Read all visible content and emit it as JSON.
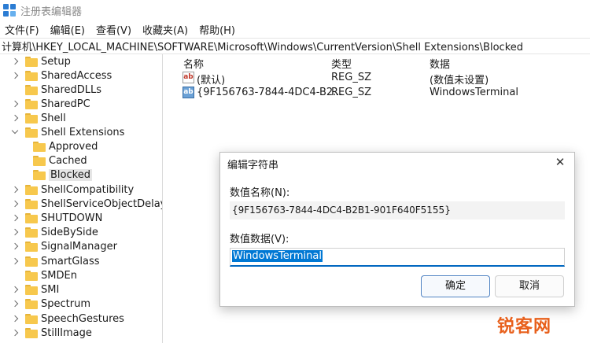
{
  "window": {
    "title": "注册表编辑器"
  },
  "menu": [
    "文件(F)",
    "编辑(E)",
    "查看(V)",
    "收藏夹(A)",
    "帮助(H)"
  ],
  "address": "计算机\\HKEY_LOCAL_MACHINE\\SOFTWARE\\Microsoft\\Windows\\CurrentVersion\\Shell Extensions\\Blocked",
  "tree": [
    {
      "label": "Setup"
    },
    {
      "label": "SharedAccess"
    },
    {
      "label": "SharedDLLs"
    },
    {
      "label": "SharedPC"
    },
    {
      "label": "Shell"
    },
    {
      "label": "Shell Extensions",
      "expanded": true
    },
    {
      "label": "Approved"
    },
    {
      "label": "Cached"
    },
    {
      "label": "Blocked",
      "selected": true
    },
    {
      "label": "ShellCompatibility"
    },
    {
      "label": "ShellServiceObjectDelayLoad"
    },
    {
      "label": "SHUTDOWN"
    },
    {
      "label": "SideBySide"
    },
    {
      "label": "SignalManager"
    },
    {
      "label": "SmartGlass"
    },
    {
      "label": "SMDEn"
    },
    {
      "label": "SMI"
    },
    {
      "label": "Spectrum"
    },
    {
      "label": "SpeechGestures"
    },
    {
      "label": "StillImage"
    }
  ],
  "list": {
    "headers": {
      "name": "名称",
      "type": "类型",
      "data": "数据"
    },
    "rows": [
      {
        "icon": "string-value-icon",
        "glyph": "ab",
        "name": "(默认)",
        "type": "REG_SZ",
        "data": "(数值未设置)"
      },
      {
        "icon": "string-value-icon",
        "glyph": "ab",
        "name": "{9F156763-7844-4DC4-B2...",
        "type": "REG_SZ",
        "data": "WindowsTerminal"
      }
    ]
  },
  "dialog": {
    "title": "编辑字符串",
    "name_label": "数值名称(N):",
    "name_value": "{9F156763-7844-4DC4-B2B1-901F640F5155}",
    "data_label": "数值数据(V):",
    "data_value": "WindowsTerminal",
    "ok_label": "确定",
    "cancel_label": "取消",
    "close_glyph": "✕"
  },
  "watermark": "锐客网",
  "colors": {
    "accent": "#0078d4",
    "folder": "#f7c84d",
    "watermark": "#e8601c"
  }
}
